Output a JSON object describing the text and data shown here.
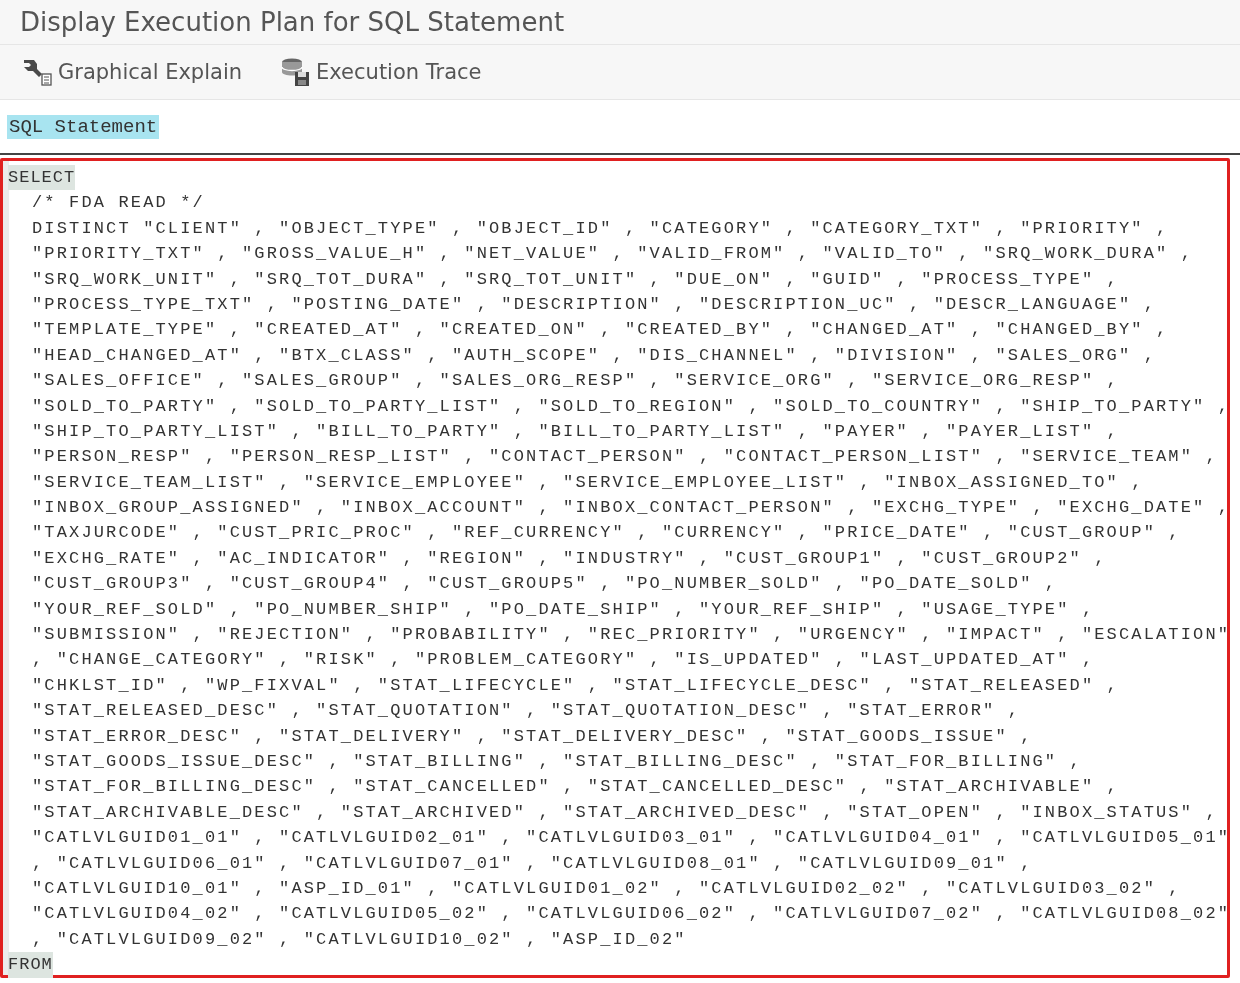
{
  "window": {
    "title": "Display Execution Plan for SQL Statement"
  },
  "toolbar": [
    {
      "kind": "explain",
      "label": "Graphical Explain"
    },
    {
      "kind": "trace",
      "label": "Execution Trace"
    }
  ],
  "section_label": "SQL Statement",
  "code_lines": [
    {
      "kind": "keyword",
      "text": "SELECT"
    },
    {
      "kind": "code",
      "text": "/* FDA READ */"
    },
    {
      "kind": "code",
      "text": "DISTINCT \"CLIENT\" , \"OBJECT_TYPE\" , \"OBJECT_ID\" , \"CATEGORY\" , \"CATEGORY_TXT\" , \"PRIORITY\" ,"
    },
    {
      "kind": "code",
      "text": "\"PRIORITY_TXT\" , \"GROSS_VALUE_H\" , \"NET_VALUE\" , \"VALID_FROM\" , \"VALID_TO\" , \"SRQ_WORK_DURA\" ,"
    },
    {
      "kind": "code",
      "text": "\"SRQ_WORK_UNIT\" , \"SRQ_TOT_DURA\" , \"SRQ_TOT_UNIT\" , \"DUE_ON\" , \"GUID\" , \"PROCESS_TYPE\" ,"
    },
    {
      "kind": "code",
      "text": "\"PROCESS_TYPE_TXT\" , \"POSTING_DATE\" , \"DESCRIPTION\" , \"DESCRIPTION_UC\" , \"DESCR_LANGUAGE\" ,"
    },
    {
      "kind": "code",
      "text": "\"TEMPLATE_TYPE\" , \"CREATED_AT\" , \"CREATED_ON\" , \"CREATED_BY\" , \"CHANGED_AT\" , \"CHANGED_BY\" ,"
    },
    {
      "kind": "code",
      "text": "\"HEAD_CHANGED_AT\" , \"BTX_CLASS\" , \"AUTH_SCOPE\" , \"DIS_CHANNEL\" , \"DIVISION\" , \"SALES_ORG\" ,"
    },
    {
      "kind": "code",
      "text": "\"SALES_OFFICE\" , \"SALES_GROUP\" , \"SALES_ORG_RESP\" , \"SERVICE_ORG\" , \"SERVICE_ORG_RESP\" ,"
    },
    {
      "kind": "code",
      "text": "\"SOLD_TO_PARTY\" , \"SOLD_TO_PARTY_LIST\" , \"SOLD_TO_REGION\" , \"SOLD_TO_COUNTRY\" , \"SHIP_TO_PARTY\" ,"
    },
    {
      "kind": "code",
      "text": "\"SHIP_TO_PARTY_LIST\" , \"BILL_TO_PARTY\" , \"BILL_TO_PARTY_LIST\" , \"PAYER\" , \"PAYER_LIST\" ,"
    },
    {
      "kind": "code",
      "text": "\"PERSON_RESP\" , \"PERSON_RESP_LIST\" , \"CONTACT_PERSON\" , \"CONTACT_PERSON_LIST\" , \"SERVICE_TEAM\" ,"
    },
    {
      "kind": "code",
      "text": "\"SERVICE_TEAM_LIST\" , \"SERVICE_EMPLOYEE\" , \"SERVICE_EMPLOYEE_LIST\" , \"INBOX_ASSIGNED_TO\" ,"
    },
    {
      "kind": "code",
      "text": "\"INBOX_GROUP_ASSIGNED\" , \"INBOX_ACCOUNT\" , \"INBOX_CONTACT_PERSON\" , \"EXCHG_TYPE\" , \"EXCHG_DATE\" ,"
    },
    {
      "kind": "code",
      "text": "\"TAXJURCODE\" , \"CUST_PRIC_PROC\" , \"REF_CURRENCY\" , \"CURRENCY\" , \"PRICE_DATE\" , \"CUST_GROUP\" ,"
    },
    {
      "kind": "code",
      "text": "\"EXCHG_RATE\" , \"AC_INDICATOR\" , \"REGION\" , \"INDUSTRY\" , \"CUST_GROUP1\" , \"CUST_GROUP2\" ,"
    },
    {
      "kind": "code",
      "text": "\"CUST_GROUP3\" , \"CUST_GROUP4\" , \"CUST_GROUP5\" , \"PO_NUMBER_SOLD\" , \"PO_DATE_SOLD\" ,"
    },
    {
      "kind": "code",
      "text": "\"YOUR_REF_SOLD\" , \"PO_NUMBER_SHIP\" , \"PO_DATE_SHIP\" , \"YOUR_REF_SHIP\" , \"USAGE_TYPE\" ,"
    },
    {
      "kind": "code",
      "text": "\"SUBMISSION\" , \"REJECTION\" , \"PROBABILITY\" , \"REC_PRIORITY\" , \"URGENCY\" , \"IMPACT\" , \"ESCALATION\""
    },
    {
      "kind": "code",
      "text": ", \"CHANGE_CATEGORY\" , \"RISK\" , \"PROBLEM_CATEGORY\" , \"IS_UPDATED\" , \"LAST_UPDATED_AT\" ,"
    },
    {
      "kind": "code",
      "text": "\"CHKLST_ID\" , \"WP_FIXVAL\" , \"STAT_LIFECYCLE\" , \"STAT_LIFECYCLE_DESC\" , \"STAT_RELEASED\" ,"
    },
    {
      "kind": "code",
      "text": "\"STAT_RELEASED_DESC\" , \"STAT_QUOTATION\" , \"STAT_QUOTATION_DESC\" , \"STAT_ERROR\" ,"
    },
    {
      "kind": "code",
      "text": "\"STAT_ERROR_DESC\" , \"STAT_DELIVERY\" , \"STAT_DELIVERY_DESC\" , \"STAT_GOODS_ISSUE\" ,"
    },
    {
      "kind": "code",
      "text": "\"STAT_GOODS_ISSUE_DESC\" , \"STAT_BILLING\" , \"STAT_BILLING_DESC\" , \"STAT_FOR_BILLING\" ,"
    },
    {
      "kind": "code",
      "text": "\"STAT_FOR_BILLING_DESC\" , \"STAT_CANCELLED\" , \"STAT_CANCELLED_DESC\" , \"STAT_ARCHIVABLE\" ,"
    },
    {
      "kind": "code",
      "text": "\"STAT_ARCHIVABLE_DESC\" , \"STAT_ARCHIVED\" , \"STAT_ARCHIVED_DESC\" , \"STAT_OPEN\" , \"INBOX_STATUS\" ,"
    },
    {
      "kind": "code",
      "text": "\"CATLVLGUID01_01\" , \"CATLVLGUID02_01\" , \"CATLVLGUID03_01\" , \"CATLVLGUID04_01\" , \"CATLVLGUID05_01\""
    },
    {
      "kind": "code",
      "text": ", \"CATLVLGUID06_01\" , \"CATLVLGUID07_01\" , \"CATLVLGUID08_01\" , \"CATLVLGUID09_01\" ,"
    },
    {
      "kind": "code",
      "text": "\"CATLVLGUID10_01\" , \"ASP_ID_01\" , \"CATLVLGUID01_02\" , \"CATLVLGUID02_02\" , \"CATLVLGUID03_02\" ,"
    },
    {
      "kind": "code",
      "text": "\"CATLVLGUID04_02\" , \"CATLVLGUID05_02\" , \"CATLVLGUID06_02\" , \"CATLVLGUID07_02\" , \"CATLVLGUID08_02\""
    },
    {
      "kind": "code",
      "text": ", \"CATLVLGUID09_02\" , \"CATLVLGUID10_02\" , \"ASP_ID_02\""
    },
    {
      "kind": "keyword",
      "text": "FROM"
    }
  ]
}
